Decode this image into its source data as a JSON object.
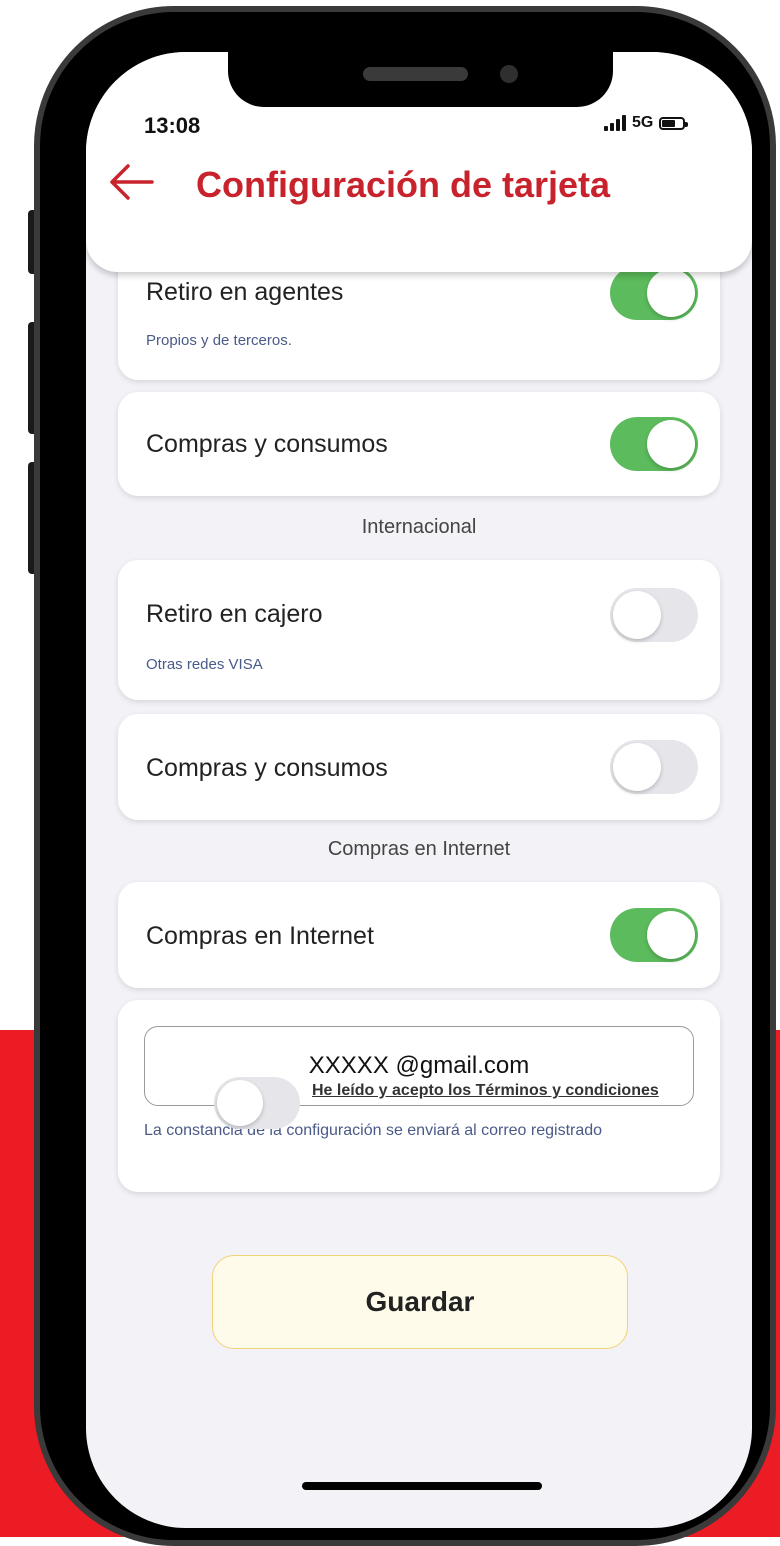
{
  "status_bar": {
    "time": "13:08",
    "network": "5G"
  },
  "header": {
    "title": "Configuración de tarjeta"
  },
  "nacional": {
    "retiro_agentes": {
      "label": "Retiro en agentes",
      "subtitle": "Propios y de terceros.",
      "enabled": true
    },
    "compras_consumos": {
      "label": "Compras y consumos",
      "enabled": true
    }
  },
  "internacional": {
    "section_title": "Internacional",
    "retiro_cajero": {
      "label": "Retiro en cajero",
      "subtitle": "Otras redes VISA",
      "enabled": false
    },
    "compras_consumos": {
      "label": "Compras y consumos",
      "enabled": false
    }
  },
  "internet": {
    "section_title": "Compras en Internet",
    "compras_internet": {
      "label": "Compras en Internet",
      "enabled": true
    }
  },
  "email": {
    "value": "XXXXX @gmail.com",
    "note": "La constancia de la configuración se enviará al correo registrado"
  },
  "terms": {
    "label": "He leído y acepto los Términos y condiciones",
    "accepted": false
  },
  "save_label": "Guardar",
  "colors": {
    "accent_red": "#c8232c",
    "toggle_on": "#5cbb5c",
    "background_red": "#ec1c24"
  }
}
